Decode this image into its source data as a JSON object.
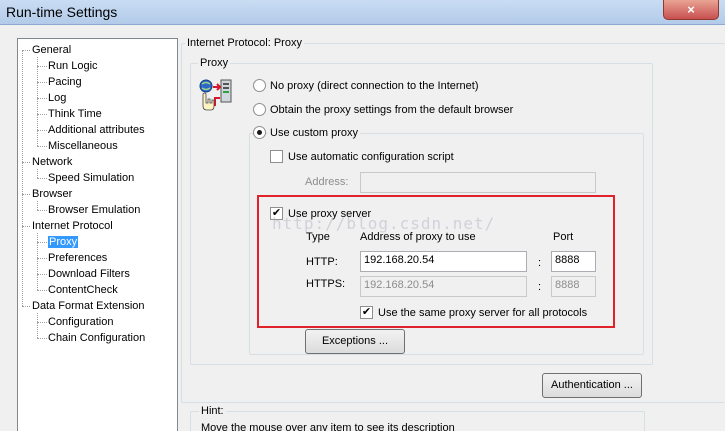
{
  "window": {
    "title": "Run-time Settings",
    "close_label": "×"
  },
  "tree": {
    "items": [
      {
        "label": "General",
        "level": 0
      },
      {
        "label": "Run Logic",
        "level": 1
      },
      {
        "label": "Pacing",
        "level": 1
      },
      {
        "label": "Log",
        "level": 1
      },
      {
        "label": "Think Time",
        "level": 1
      },
      {
        "label": "Additional attributes",
        "level": 1
      },
      {
        "label": "Miscellaneous",
        "level": 1
      },
      {
        "label": "Network",
        "level": 0
      },
      {
        "label": "Speed Simulation",
        "level": 1
      },
      {
        "label": "Browser",
        "level": 0
      },
      {
        "label": "Browser Emulation",
        "level": 1
      },
      {
        "label": "Internet Protocol",
        "level": 0
      },
      {
        "label": "Proxy",
        "level": 1,
        "selected": true
      },
      {
        "label": "Preferences",
        "level": 1
      },
      {
        "label": "Download Filters",
        "level": 1
      },
      {
        "label": "ContentCheck",
        "level": 1
      },
      {
        "label": "Data Format Extension",
        "level": 0
      },
      {
        "label": "Configuration",
        "level": 1
      },
      {
        "label": "Chain Configuration",
        "level": 1
      }
    ]
  },
  "panel": {
    "title": "Internet Protocol: Proxy",
    "proxy_group_title": "Proxy",
    "no_proxy_label": "No proxy (direct connection to the Internet)",
    "obtain_label": "Obtain the proxy settings from the default browser",
    "custom_label": "Use custom proxy",
    "auto_config_label": "Use automatic configuration script",
    "address_label": "Address:",
    "address_value": "",
    "use_proxy_server_label": "Use proxy server",
    "watermark": "http://blog.csdn.net/",
    "col_type": "Type",
    "col_address": "Address of proxy to use",
    "col_port": "Port",
    "http_label": "HTTP:",
    "http_address": "192.168.20.54",
    "http_port": "8888",
    "https_label": "HTTPS:",
    "https_address": "192.168.20.54",
    "https_port": "8888",
    "colon": ":",
    "same_proxy_label": "Use the same proxy server for all protocols",
    "exceptions_button": "Exceptions ...",
    "authentication_button": "Authentication ...",
    "hint_title": "Hint:",
    "hint_text": "Move the mouse over any item to see its description"
  },
  "states": {
    "selected_radio": "Use custom proxy",
    "auto_config_checked": false,
    "use_proxy_server_checked": true,
    "same_proxy_checked": true
  },
  "colors": {
    "highlight_box": "#e0232a",
    "selection": "#3399ff"
  }
}
